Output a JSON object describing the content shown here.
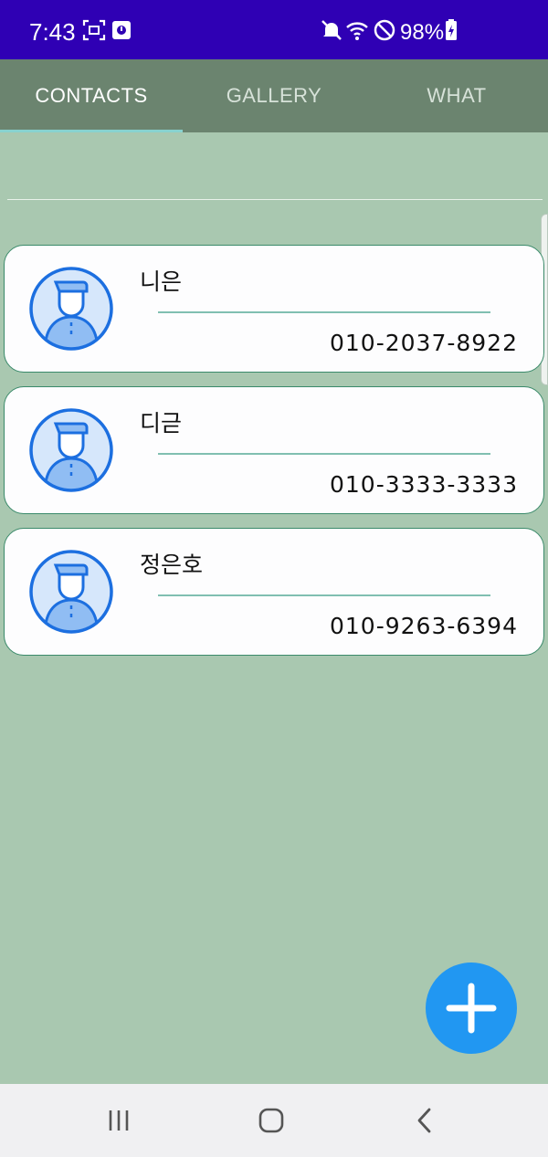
{
  "status_bar": {
    "time": "7:43",
    "battery": "98%",
    "background": "#2f00b4",
    "icons": [
      "screenshot-icon",
      "media-icon",
      "mute-icon",
      "wifi-icon",
      "dnd-icon",
      "battery-charging-icon"
    ]
  },
  "tabs": [
    {
      "label": "CONTACTS",
      "active": true
    },
    {
      "label": "GALLERY",
      "active": false
    },
    {
      "label": "WHAT",
      "active": false
    }
  ],
  "contacts": [
    {
      "name": "니은",
      "phone": "010-2037-8922"
    },
    {
      "name": "디귿",
      "phone": "010-3333-3333"
    },
    {
      "name": "정은호",
      "phone": "010-9263-6394"
    }
  ],
  "fab": {
    "icon": "plus-icon",
    "color": "#2197f2"
  },
  "nav": {
    "icons": [
      "recents-icon",
      "home-icon",
      "back-icon"
    ]
  },
  "colors": {
    "page_bg": "#a9c8b0",
    "tab_bar": "#6b846f",
    "tab_indicator": "#88d2cf"
  }
}
